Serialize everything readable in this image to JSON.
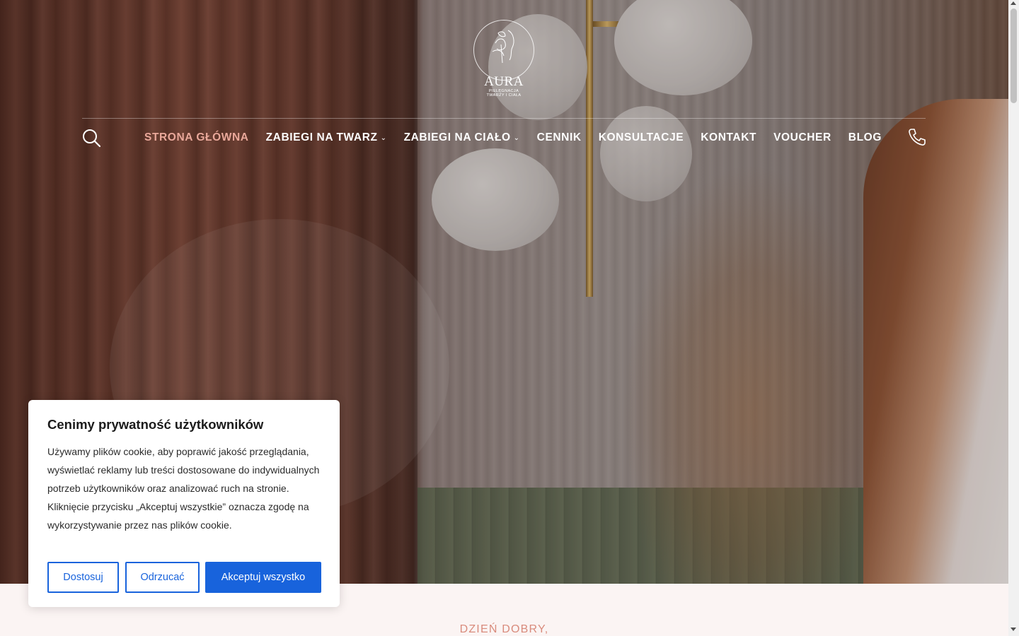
{
  "brand": {
    "name": "AURA",
    "tagline_line1": "PIELĘGNACJA",
    "tagline_line2": "TWARZY I CIAŁA"
  },
  "nav": {
    "items": [
      {
        "label": "STRONA GŁÓWNA",
        "active": true,
        "has_dropdown": false
      },
      {
        "label": "ZABIEGI NA TWARZ",
        "active": false,
        "has_dropdown": true
      },
      {
        "label": "ZABIEGI NA CIAŁO",
        "active": false,
        "has_dropdown": true
      },
      {
        "label": "CENNIK",
        "active": false,
        "has_dropdown": false
      },
      {
        "label": "KONSULTACJE",
        "active": false,
        "has_dropdown": false
      },
      {
        "label": "KONTAKT",
        "active": false,
        "has_dropdown": false
      },
      {
        "label": "VOUCHER",
        "active": false,
        "has_dropdown": false
      },
      {
        "label": "BLOG",
        "active": false,
        "has_dropdown": false
      }
    ],
    "search_icon": "search-icon",
    "phone_icon": "phone-icon"
  },
  "section": {
    "kicker": "DZIEŃ DOBRY,"
  },
  "cookie": {
    "title": "Cenimy prywatność użytkowników",
    "text": "Używamy plików cookie, aby poprawić jakość przeglądania, wyświetlać reklamy lub treści dostosowane do indywidualnych potrzeb użytkowników oraz analizować ruch na stronie. Kliknięcie przycisku „Akceptuj wszystkie” oznacza zgodę na wykorzystywanie przez nas plików cookie.",
    "customize_label": "Dostosuj",
    "reject_label": "Odrzucać",
    "accept_label": "Akceptuj wszystko"
  },
  "colors": {
    "active_nav": "#e9a89a",
    "accent_blue": "#1863dc",
    "kicker": "#d98b7c"
  }
}
